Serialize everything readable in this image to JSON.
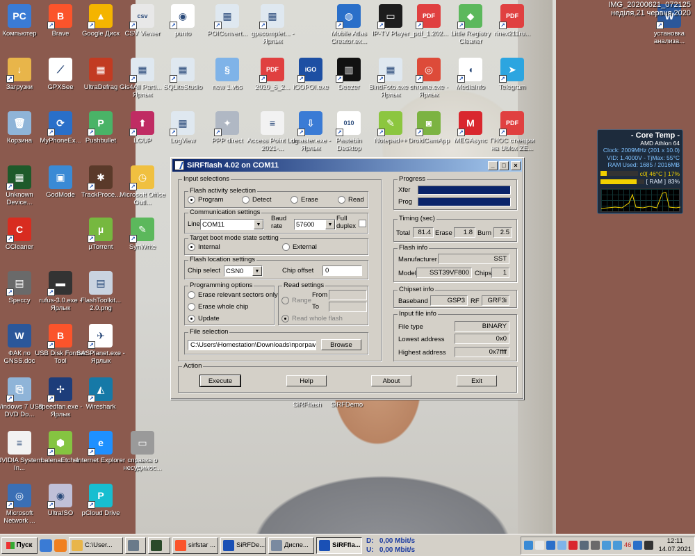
{
  "desktop": {
    "top_clock": {
      "file": "IMG_20200621_072125",
      "date": "неділя,21 червня 2020"
    },
    "icons": [
      {
        "label": "Компьютер",
        "glyph": "computer-icon",
        "color": "#3a7bd5",
        "short": "PC",
        "link": false
      },
      {
        "label": "Brave",
        "glyph": "brave-icon",
        "color": "#fb542b",
        "short": "B",
        "link": true
      },
      {
        "label": "Google Диск",
        "glyph": "google-drive-icon",
        "color": "#f4b400",
        "short": "▲",
        "link": true
      },
      {
        "label": "CSV Viewer",
        "glyph": "csv-viewer-icon",
        "color": "#e8e8e8",
        "short": "csv",
        "link": true
      },
      {
        "label": "punto",
        "glyph": "punto-icon",
        "color": "#ffffff",
        "short": "◉",
        "link": true
      },
      {
        "label": "POIConvert...",
        "glyph": "poiconvert-icon",
        "color": "#dfe8f0",
        "short": "▦",
        "link": true
      },
      {
        "label": "gpscomplet... - Ярлык",
        "glyph": "gpscomplete-icon",
        "color": "#dfe8f0",
        "short": "▦",
        "link": true
      },
      {
        "label": "Mobile Atlas Creator.ex...",
        "glyph": "globe-icon",
        "color": "#2a6fc9",
        "short": "◍",
        "link": true
      },
      {
        "label": "IP-TV Player",
        "glyph": "iptv-icon",
        "color": "#1d1d1d",
        "short": "▭",
        "link": true
      },
      {
        "label": "_pdf_1.202...",
        "glyph": "pdf-icon",
        "color": "#e04040",
        "short": "PDF",
        "link": true
      },
      {
        "label": "Little Registry Cleaner",
        "glyph": "registry-cleaner-icon",
        "color": "#5cb85c",
        "short": "◆",
        "link": true
      },
      {
        "label": "rinex211ru...",
        "glyph": "pdf-icon",
        "color": "#e04040",
        "short": "PDF",
        "link": true
      },
      {
        "label": "Загрузки",
        "glyph": "downloads-folder-icon",
        "color": "#e8b54a",
        "short": "↓",
        "link": true
      },
      {
        "label": "GPXSee",
        "glyph": "gpxsee-icon",
        "color": "#ffffff",
        "short": "⟋",
        "link": false
      },
      {
        "label": "UltraDefrag",
        "glyph": "ultradefrag-icon",
        "color": "#c23b22",
        "short": "▦",
        "link": false
      },
      {
        "label": "Gis4All Parti... - Ярлык",
        "glyph": "gis4all-icon",
        "color": "#dfe8f0",
        "short": "▦",
        "link": true
      },
      {
        "label": "SQLiteStudio",
        "glyph": "sqlitestudio-icon",
        "color": "#dfe8f0",
        "short": "▦",
        "link": true
      },
      {
        "label": "new 1.vbs",
        "glyph": "vbs-script-icon",
        "color": "#7fb3e8",
        "short": "§",
        "link": false
      },
      {
        "label": "2020_6_2...",
        "glyph": "pdf-icon",
        "color": "#e04040",
        "short": "PDF",
        "link": true
      },
      {
        "label": "iGOPOI.exe",
        "glyph": "igopoi-icon",
        "color": "#1d4fa3",
        "short": "iGO",
        "link": true
      },
      {
        "label": "Deezer",
        "glyph": "deezer-icon",
        "color": "#111111",
        "short": "▥",
        "link": true
      },
      {
        "label": "BindFoto.exe - Ярлык",
        "glyph": "bindfoto-icon",
        "color": "#dfe8f0",
        "short": "▦",
        "link": true
      },
      {
        "label": "chrome.exe - Ярлык",
        "glyph": "chrome-icon",
        "color": "#dd4b39",
        "short": "◎",
        "link": true
      },
      {
        "label": "MediaInfo",
        "glyph": "mediainfo-icon",
        "color": "#ffffff",
        "short": "◖",
        "link": true
      },
      {
        "label": "Telegram",
        "glyph": "telegram-icon",
        "color": "#2ca5e0",
        "short": "➤",
        "link": true
      },
      {
        "label": "Корзина",
        "glyph": "recycle-bin-icon",
        "color": "#8fb4d8",
        "short": "🗑",
        "link": false
      },
      {
        "label": "MyPhoneEx...",
        "glyph": "myphoneexplorer-icon",
        "color": "#2a6fc9",
        "short": "⟳",
        "link": true
      },
      {
        "label": "Pushbullet",
        "glyph": "pushbullet-icon",
        "color": "#4ab367",
        "short": "P",
        "link": true
      },
      {
        "label": "LGUP",
        "glyph": "lgup-icon",
        "color": "#c02c63",
        "short": "⬆",
        "link": true
      },
      {
        "label": "LogView",
        "glyph": "logview-icon",
        "color": "#dfe8f0",
        "short": "▦",
        "link": true
      },
      {
        "label": "PPP direct",
        "glyph": "ppp-direct-icon",
        "color": "#b0b8c4",
        "short": "✦",
        "link": true
      },
      {
        "label": "Access Point Log 2021-...",
        "glyph": "text-file-icon",
        "color": "#f2f2f2",
        "short": "≡",
        "link": false
      },
      {
        "label": "dmaster.exe - Ярлык",
        "glyph": "dmaster-icon",
        "color": "#3a7bd5",
        "short": "⇩",
        "link": true
      },
      {
        "label": "Pastebin Desktop",
        "glyph": "pastebin-icon",
        "color": "#ffffff",
        "short": "010",
        "link": true
      },
      {
        "label": "Notepad++",
        "glyph": "notepadpp-icon",
        "color": "#8cc63f",
        "short": "✎",
        "link": true
      },
      {
        "label": "DroidCamApp",
        "glyph": "droidcam-icon",
        "color": "#7cb342",
        "short": "◙",
        "link": true
      },
      {
        "label": "MEGAsync",
        "glyph": "megasync-icon",
        "color": "#d9272e",
        "short": "M",
        "link": true
      },
      {
        "label": "ГНОС станции на Ublox ZE...",
        "glyph": "pdf-icon",
        "color": "#e04040",
        "short": "PDF",
        "link": true
      },
      {
        "label": "Unknown Device...",
        "glyph": "circuit-board-icon",
        "color": "#1e5a2a",
        "short": "▦",
        "link": true
      },
      {
        "label": "GodMode",
        "glyph": "godmode-icon",
        "color": "#3a8ad5",
        "short": "▣",
        "link": false
      },
      {
        "label": "TrackProce...",
        "glyph": "trackprocessor-icon",
        "color": "#5a3a2a",
        "short": "✱",
        "link": true
      },
      {
        "label": "Microsoft Office Outl...",
        "glyph": "outlook-icon",
        "color": "#f0c040",
        "short": "◷",
        "link": true
      },
      {
        "label": "CCleaner",
        "glyph": "ccleaner-icon",
        "color": "#d82c20",
        "short": "C",
        "link": true
      },
      {
        "label": "µTorrent",
        "glyph": "utorrent-icon",
        "color": "#76b83f",
        "short": "µ",
        "link": true
      },
      {
        "label": "SynWrite",
        "glyph": "synwrite-icon",
        "color": "#5cb85c",
        "short": "✎",
        "link": true
      },
      {
        "label": "Speccy",
        "glyph": "speccy-icon",
        "color": "#6a6a6a",
        "short": "▤",
        "link": true
      },
      {
        "label": "rufus-3.0.exe - Ярлык",
        "glyph": "rufus-icon",
        "color": "#333333",
        "short": "▬",
        "link": true
      },
      {
        "label": "FlashToolkit... 2.0.png",
        "glyph": "image-file-icon",
        "color": "#c9d3e0",
        "short": "▤",
        "link": false
      },
      {
        "label": "ФАК по GNSS.doc",
        "glyph": "word-doc-icon",
        "color": "#2b579a",
        "short": "W",
        "link": false
      },
      {
        "label": "USB Disk Format Tool",
        "glyph": "brave-icon",
        "color": "#fb542b",
        "short": "B",
        "link": true
      },
      {
        "label": "SASPlanet.exe - Ярлык",
        "glyph": "sasplanet-icon",
        "color": "#ffffff",
        "short": "✈",
        "link": true
      },
      {
        "label": "Windows 7 USB DVD Do...",
        "glyph": "windows-usb-icon",
        "color": "#8fb4d8",
        "short": "⎘",
        "link": true
      },
      {
        "label": "speedfan.exe - Ярлык",
        "glyph": "speedfan-icon",
        "color": "#1d3d7a",
        "short": "✢",
        "link": true
      },
      {
        "label": "Wireshark",
        "glyph": "wireshark-icon",
        "color": "#1679a7",
        "short": "◭",
        "link": true
      },
      {
        "label": "NVIDIA System In...",
        "glyph": "text-file-icon",
        "color": "#f2f2f2",
        "short": "≡",
        "link": false
      },
      {
        "label": "balenaEtcher",
        "glyph": "balenaetcher-icon",
        "color": "#85c441",
        "short": "⬢",
        "link": true
      },
      {
        "label": "Internet Explorer",
        "glyph": "internet-explorer-icon",
        "color": "#1e90ff",
        "short": "e",
        "link": true
      },
      {
        "label": "справка о несудимос...",
        "glyph": "scanned-doc-icon",
        "color": "#9a9a9a",
        "short": "▭",
        "link": false
      },
      {
        "label": "Microsoft Network ...",
        "glyph": "network-monitor-icon",
        "color": "#3a6fb5",
        "short": "◎",
        "link": true
      },
      {
        "label": "UltraISO",
        "glyph": "ultraiso-icon",
        "color": "#c0c0d8",
        "short": "◉",
        "link": true
      },
      {
        "label": "pCloud Drive",
        "glyph": "pcloud-icon",
        "color": "#17bed0",
        "short": "P",
        "link": true
      },
      {
        "label": "установка анализа...",
        "glyph": "word-doc-icon",
        "color": "#2b579a",
        "short": "W",
        "link": true
      },
      {
        "label": "SiRFflash",
        "glyph": "sirfflash-icon",
        "color": "#1a50b5",
        "short": "⟋",
        "link": true
      },
      {
        "label": "SiRFDemo",
        "glyph": "sirfdemo-icon",
        "color": "#1a50b5",
        "short": "⟋",
        "link": true
      }
    ]
  },
  "coretemp": {
    "title": "- Core Temp -",
    "cpu": "AMD Athlon 64",
    "clock": "Clock: 2009MHz (201 x 10.0)",
    "vid": "VID: 1.4000V - TjMax: 55°C",
    "ram": "RAM Used: 1685 / 2016MB",
    "c0_label": "c0[ 46°C ]",
    "c0_pct": "17%",
    "c0_fill": 0.17,
    "ram_label": "[ RAM ]",
    "ram_pct": "83%",
    "ram_fill": 0.83
  },
  "window": {
    "title": "SiRFflash 4.02 on COM11",
    "minimize": "_",
    "maximize": "□",
    "close": "×",
    "input_selections": {
      "legend": "Input selections",
      "flash_activity": {
        "legend": "Flash activity selection",
        "options": [
          "Program",
          "Detect",
          "Erase",
          "Read"
        ],
        "selected": "Program"
      },
      "comm": {
        "legend": "Communication settings",
        "line_label": "Line",
        "line_value": "COM11",
        "baud_label": "Baud rate",
        "baud_value": "57600",
        "duplex_label": "Full duplex"
      },
      "boot": {
        "legend": "Target boot mode state setting",
        "options": [
          "Internal",
          "External"
        ],
        "selected": "Internal"
      },
      "location": {
        "legend": "Flash location settings",
        "chip_select_label": "Chip select",
        "chip_select_value": "CSN0",
        "chip_offset_label": "Chip offset",
        "chip_offset_value": "0"
      },
      "programming": {
        "legend": "Programming options",
        "options": [
          "Erase relevant sectors only",
          "Erase whole chip",
          "Update"
        ],
        "selected": "Update"
      },
      "read": {
        "legend": "Read settings",
        "range_label": "Range",
        "from_label": "From",
        "to_label": "To",
        "read_whole": "Read whole flash"
      },
      "file": {
        "legend": "File selection",
        "path": "C:\\Users\\Homestation\\Downloads\\программы\\S",
        "browse": "Browse"
      }
    },
    "progress": {
      "legend": "Progress",
      "xfer_label": "Xfer",
      "prog_label": "Prog",
      "xfer_fill": 1.0,
      "prog_fill": 1.0
    },
    "timing": {
      "legend": "Timing (sec)",
      "total_label": "Total",
      "total_value": "81.4",
      "erase_label": "Erase",
      "erase_value": "1.8",
      "burn_label": "Burn",
      "burn_value": "2.5"
    },
    "flash_info": {
      "legend": "Flash info",
      "manufacturer_label": "Manufacturer",
      "manufacturer_value": "SST",
      "model_label": "Model",
      "model_value": "SST39VF800",
      "chips_label": "Chips",
      "chips_value": "1"
    },
    "chipset_info": {
      "legend": "Chipset info",
      "baseband_label": "Baseband",
      "baseband_value": "GSP3",
      "rf_label": "RF",
      "rf_value": "GRF3i"
    },
    "input_file_info": {
      "legend": "Input file info",
      "file_type_label": "File type",
      "file_type_value": "BINARY",
      "lowest_label": "Lowest address",
      "lowest_value": "0x0",
      "highest_label": "Highest address",
      "highest_value": "0x7ffff"
    },
    "action": {
      "legend": "Action",
      "execute": "Execute",
      "help": "Help",
      "about": "About",
      "exit": "Exit"
    }
  },
  "taskbar": {
    "start": "Пуск",
    "tasks": [
      {
        "label": "C:\\User...",
        "icon": "folder-icon",
        "color": "#e8b54a",
        "active": false
      },
      {
        "label": "",
        "icon": "calculator-icon",
        "color": "#6a7a8a",
        "active": false
      },
      {
        "label": "",
        "icon": "terminal-icon",
        "color": "#2a4a2a",
        "active": false
      },
      {
        "label": "sirfstar ...",
        "icon": "brave-icon",
        "color": "#fb542b",
        "active": false
      },
      {
        "label": "SiRFDe...",
        "icon": "sirfdemo-icon",
        "color": "#1a50b5",
        "active": false
      },
      {
        "label": "Диспе...",
        "icon": "device-manager-icon",
        "color": "#7a8aa0",
        "active": false
      },
      {
        "label": "SiRFfla...",
        "icon": "sirfflash-icon",
        "color": "#1a50b5",
        "active": true
      }
    ],
    "net": {
      "d_label": "D:",
      "u_label": "U:",
      "d_value": "0,00 Mbit/s",
      "u_value": "0,00 Mbit/s"
    },
    "tray_count": "46",
    "time": "12:11",
    "date": "14.07.2021"
  }
}
